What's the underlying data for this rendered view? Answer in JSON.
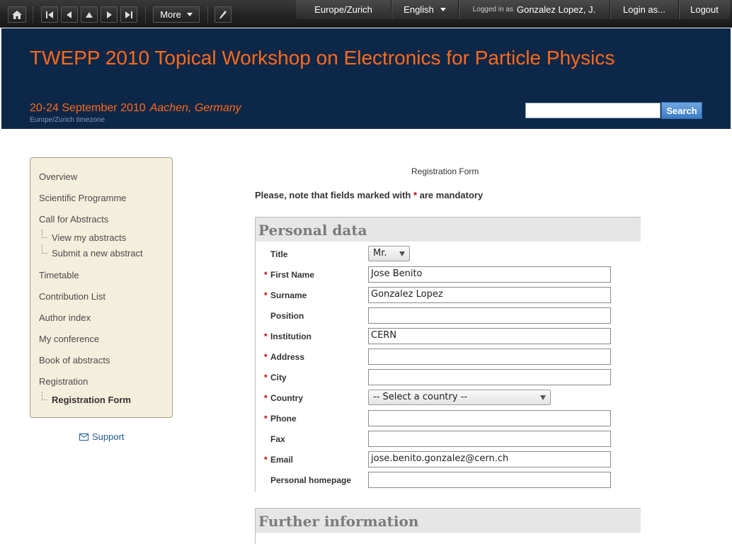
{
  "toolbar": {
    "more_label": "More",
    "timezone": "Europe/Zurich",
    "language": "English",
    "logged_in_prefix": "Logged in as",
    "user_name": "Gonzalez Lopez, J.",
    "login_as": "Login as...",
    "logout": "Logout"
  },
  "header": {
    "title": "TWEPP 2010 Topical Workshop on Electronics for Particle Physics",
    "dates": "20-24 September 2010",
    "location": "Aachen, Germany",
    "timezone_note": "Europe/Zurich timezone",
    "search_label": "Search"
  },
  "sidebar": {
    "items": {
      "overview": "Overview",
      "scientific_programme": "Scientific Programme",
      "call_for_abstracts": "Call for Abstracts",
      "view_abstracts": "View my abstracts",
      "submit_abstract": "Submit a new abstract",
      "timetable": "Timetable",
      "contribution_list": "Contribution List",
      "author_index": "Author index",
      "my_conference": "My conference",
      "book_of_abstracts": "Book of abstracts",
      "registration": "Registration",
      "registration_form": "Registration Form"
    },
    "support": "Support"
  },
  "form": {
    "title": "Registration Form",
    "note_before": "Please, note that fields marked with ",
    "note_star": "*",
    "note_after": " are mandatory",
    "section_personal": "Personal data",
    "section_further": "Further information",
    "required_mark": "*",
    "fields": {
      "title": {
        "label": "Title",
        "value": "Mr."
      },
      "first_name": {
        "label": "First Name",
        "value": "Jose Benito"
      },
      "surname": {
        "label": "Surname",
        "value": "Gonzalez Lopez"
      },
      "position": {
        "label": "Position",
        "value": ""
      },
      "institution": {
        "label": "Institution",
        "value": "CERN"
      },
      "address": {
        "label": "Address",
        "value": ""
      },
      "city": {
        "label": "City",
        "value": ""
      },
      "country": {
        "label": "Country",
        "value": "-- Select a country --"
      },
      "phone": {
        "label": "Phone",
        "value": ""
      },
      "fax": {
        "label": "Fax",
        "value": ""
      },
      "email": {
        "label": "Email",
        "value": "jose.benito.gonzalez@cern.ch"
      },
      "homepage": {
        "label": "Personal homepage",
        "value": ""
      }
    }
  },
  "colors": {
    "header_bg": "#0c2748",
    "title_orange": "#ff6a1a",
    "sidebar_bg": "#f4efdc",
    "required_red": "#cc0000"
  }
}
